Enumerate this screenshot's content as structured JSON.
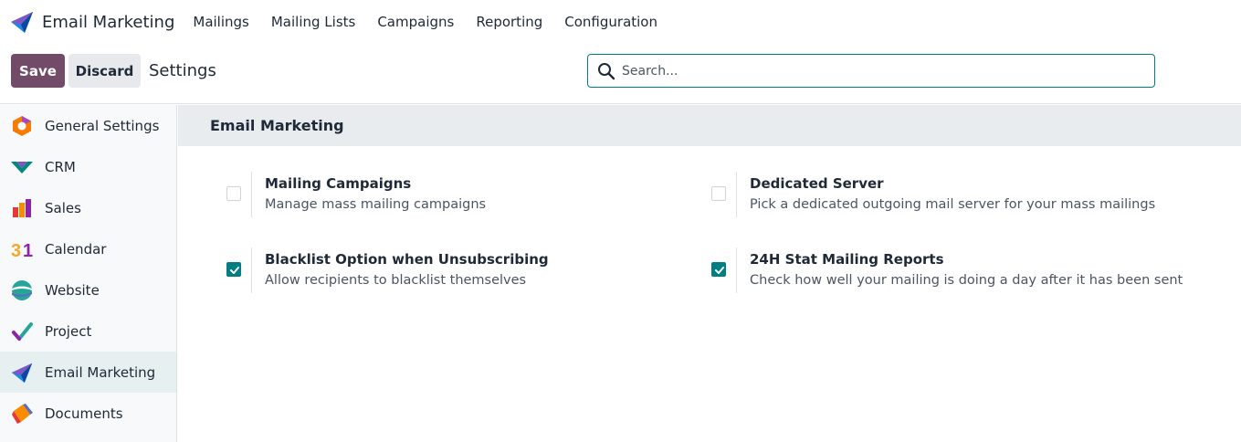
{
  "app": {
    "title": "Email Marketing"
  },
  "menu": [
    {
      "label": "Mailings"
    },
    {
      "label": "Mailing Lists"
    },
    {
      "label": "Campaigns"
    },
    {
      "label": "Reporting"
    },
    {
      "label": "Configuration"
    }
  ],
  "controls": {
    "save_label": "Save",
    "discard_label": "Discard",
    "page_title": "Settings",
    "search_placeholder": "Search...",
    "search_value": ""
  },
  "sidebar": {
    "items": [
      {
        "label": "General Settings",
        "icon": "general-settings-icon",
        "active": false
      },
      {
        "label": "CRM",
        "icon": "crm-icon",
        "active": false
      },
      {
        "label": "Sales",
        "icon": "sales-icon",
        "active": false
      },
      {
        "label": "Calendar",
        "icon": "calendar-icon",
        "active": false
      },
      {
        "label": "Website",
        "icon": "website-icon",
        "active": false
      },
      {
        "label": "Project",
        "icon": "project-icon",
        "active": false
      },
      {
        "label": "Email Marketing",
        "icon": "email-marketing-icon",
        "active": true
      },
      {
        "label": "Documents",
        "icon": "documents-icon",
        "active": false
      }
    ]
  },
  "section": {
    "title": "Email Marketing",
    "settings": [
      {
        "title": "Mailing Campaigns",
        "description": "Manage mass mailing campaigns",
        "checked": false
      },
      {
        "title": "Dedicated Server",
        "description": "Pick a dedicated outgoing mail server for your mass mailings",
        "checked": false
      },
      {
        "title": "Blacklist Option when Unsubscribing",
        "description": "Allow recipients to blacklist themselves",
        "checked": true
      },
      {
        "title": "24H Stat Mailing Reports",
        "description": "Check how well your mailing is doing a day after it has been sent",
        "checked": true
      }
    ]
  },
  "colors": {
    "primary": "#714b67",
    "accent": "#017e84",
    "active_bg": "#e6f0f1"
  }
}
